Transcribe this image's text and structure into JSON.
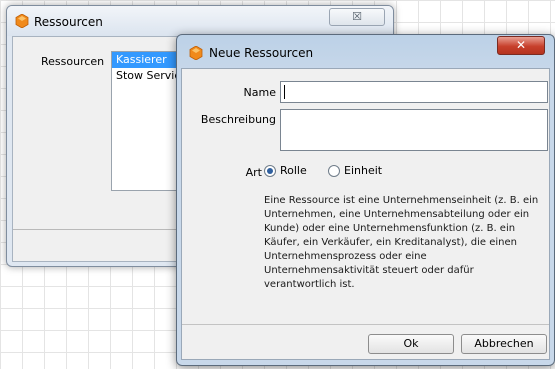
{
  "back_window": {
    "title": "Ressourcen",
    "close_glyph": "☒",
    "list_label": "Ressourcen",
    "items": [
      "Kassierer",
      "Stow Servic"
    ],
    "selected_index": 0
  },
  "dialog": {
    "title": "Neue Ressourcen",
    "close_glyph": "✕",
    "name_label": "Name",
    "name_value": "",
    "description_label": "Beschreibung",
    "description_value": "",
    "type_label": "Art",
    "radio_options": [
      {
        "label": "Rolle",
        "checked": true
      },
      {
        "label": "Einheit",
        "checked": false
      }
    ],
    "help_text": "Eine Ressource ist eine Unternehmenseinheit (z. B. ein Unternehmen, eine Unternehmensabteilung oder ein Kunde) oder eine Unternehmensfunktion (z. B. ein Käufer, ein Verkäufer, ein Kreditanalyst), die einen Unternehmensprozess oder eine Unternehmensaktivität steuert oder dafür verantwortlich ist.",
    "ok_label": "Ok",
    "cancel_label": "Abbrechen"
  },
  "icons": {
    "app_icon": "orange-hexagon-icon"
  },
  "colors": {
    "selection": "#3399ff",
    "close_button": "#c7402c",
    "dialog_frame": "#c8d8ea"
  }
}
